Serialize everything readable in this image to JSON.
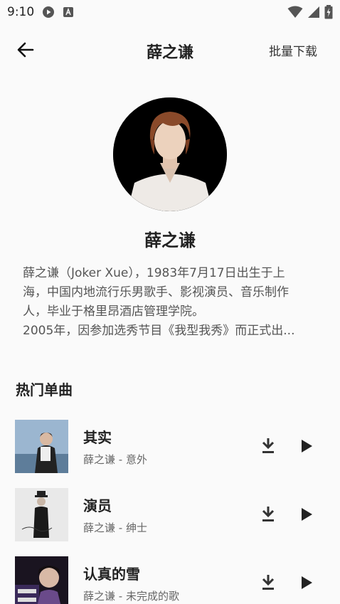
{
  "status_bar": {
    "time": "9:10"
  },
  "header": {
    "title": "薛之谦",
    "batch_download": "批量下载"
  },
  "artist": {
    "name": "薛之谦",
    "bio_lines": [
      "薛之谦（Joker Xue），1983年7月17日出生于上",
      "海，中国内地流行乐男歌手、影视演员、音乐制作",
      "人，毕业于格里昂酒店管理学院。",
      "2005年，因参加选秀节目《我型我秀》而正式出..."
    ]
  },
  "section": {
    "title": "热门单曲"
  },
  "songs": [
    {
      "name": "其实",
      "sub": "薛之谦 - 意外"
    },
    {
      "name": "演员",
      "sub": "薛之谦 - 绅士"
    },
    {
      "name": "认真的雪",
      "sub": "薛之谦 - 未完成的歌"
    }
  ],
  "icons": {
    "back": "arrow-left-icon",
    "download": "download-icon",
    "play": "play-icon"
  }
}
